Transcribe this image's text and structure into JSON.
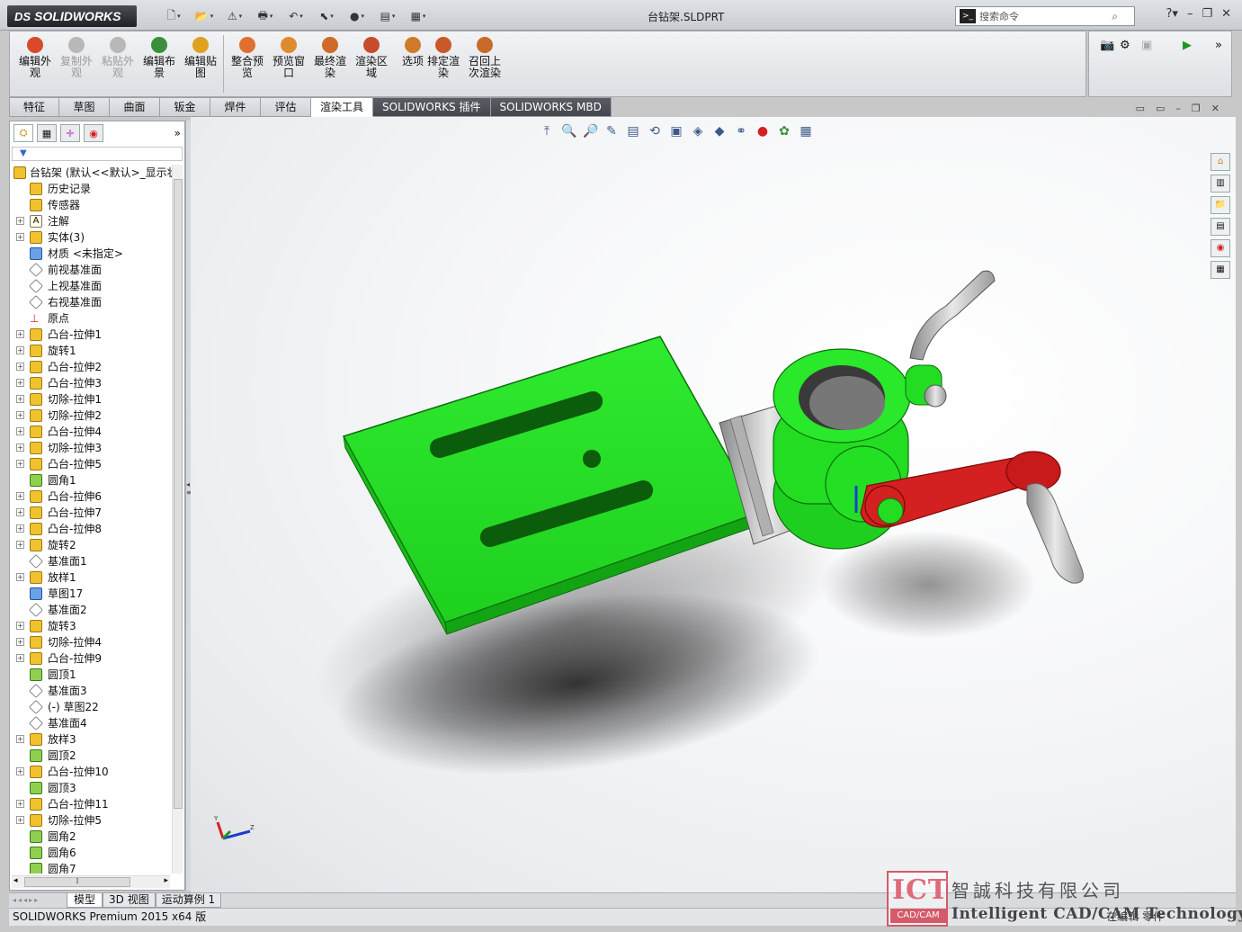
{
  "app": {
    "logo_text": "SOLIDWORKS",
    "logo_prefix": "DS",
    "document_title": "台钻架.SLDPRT",
    "search_placeholder": "搜索命令",
    "status_text": "SOLIDWORKS Premium 2015 x64 版",
    "status_right": "在编辑 零件"
  },
  "quick_access": [
    {
      "icon": "new-document-icon",
      "glyph": "🗋"
    },
    {
      "icon": "open-folder-icon",
      "glyph": "📂"
    },
    {
      "icon": "rebuild-icon",
      "glyph": "⚠"
    },
    {
      "icon": "print-icon",
      "glyph": "🖶"
    },
    {
      "icon": "undo-icon",
      "glyph": "↶"
    },
    {
      "icon": "select-icon",
      "glyph": "⬉"
    },
    {
      "icon": "traffic-light-icon",
      "glyph": "●"
    },
    {
      "icon": "file-properties-icon",
      "glyph": "▤"
    },
    {
      "icon": "options-icon",
      "glyph": "▦"
    }
  ],
  "commands": [
    {
      "name": "edit-appearance",
      "label": "编辑外观",
      "color": "#d94a2c",
      "disabled": false
    },
    {
      "name": "copy-appearance",
      "label": "复制外观",
      "color": "#b8b8b8",
      "disabled": true
    },
    {
      "name": "paste-appearance",
      "label": "粘贴外观",
      "color": "#b8b8b8",
      "disabled": true
    },
    {
      "name": "edit-scene",
      "label": "编辑布景",
      "color": "#3b8f3b",
      "disabled": false
    },
    {
      "name": "edit-decal",
      "label": "编辑贴图",
      "color": "#e0a020",
      "disabled": false
    },
    {
      "name": "integrated-preview",
      "label": "整合预览",
      "color": "#e07030",
      "disabled": false
    },
    {
      "name": "preview-window",
      "label": "预览窗口",
      "color": "#e08a30",
      "disabled": false
    },
    {
      "name": "final-render",
      "label": "最终渲染",
      "color": "#d06a28",
      "disabled": false
    },
    {
      "name": "render-region",
      "label": "渲染区域",
      "color": "#c84c2c",
      "disabled": false
    },
    {
      "name": "options",
      "label": "选项",
      "color": "#d07a2a",
      "disabled": false
    },
    {
      "name": "schedule-render",
      "label": "排定渲染",
      "color": "#c85a2a",
      "disabled": false
    },
    {
      "name": "recall-last-render",
      "label": "召回上次渲染",
      "color": "#c86a2a",
      "disabled": false
    }
  ],
  "tabs": [
    {
      "label": "特征",
      "active": false,
      "dark": false
    },
    {
      "label": "草图",
      "active": false,
      "dark": false
    },
    {
      "label": "曲面",
      "active": false,
      "dark": false
    },
    {
      "label": "钣金",
      "active": false,
      "dark": false
    },
    {
      "label": "焊件",
      "active": false,
      "dark": false
    },
    {
      "label": "评估",
      "active": false,
      "dark": false
    },
    {
      "label": "渲染工具",
      "active": true,
      "dark": false
    },
    {
      "label": "SOLIDWORKS 插件",
      "active": false,
      "dark": true
    },
    {
      "label": "SOLIDWORKS MBD",
      "active": false,
      "dark": true
    }
  ],
  "tree": {
    "root": "台钻架  (默认<<默认>_显示状",
    "nodes": [
      {
        "label": "历史记录",
        "icon": "history-icon",
        "cls": "yellow",
        "exp": false
      },
      {
        "label": "传感器",
        "icon": "sensor-icon",
        "cls": "yellow",
        "exp": false
      },
      {
        "label": "注解",
        "icon": "annotation-icon",
        "cls": "text",
        "glyph": "A",
        "exp": true
      },
      {
        "label": "实体(3)",
        "icon": "solid-bodies-icon",
        "cls": "yellow",
        "exp": true
      },
      {
        "label": "材质 <未指定>",
        "icon": "material-icon",
        "cls": "blue",
        "exp": false
      },
      {
        "label": "前视基准面",
        "icon": "plane-icon",
        "cls": "plane",
        "exp": false
      },
      {
        "label": "上视基准面",
        "icon": "plane-icon",
        "cls": "plane",
        "exp": false
      },
      {
        "label": "右视基准面",
        "icon": "plane-icon",
        "cls": "plane",
        "exp": false
      },
      {
        "label": "原点",
        "icon": "origin-icon",
        "cls": "origin",
        "glyph": "⊥",
        "exp": false
      },
      {
        "label": "凸台-拉伸1",
        "icon": "boss-extrude-icon",
        "cls": "yellow",
        "exp": true
      },
      {
        "label": "旋转1",
        "icon": "revolve-icon",
        "cls": "yellow",
        "exp": true
      },
      {
        "label": "凸台-拉伸2",
        "icon": "boss-extrude-icon",
        "cls": "yellow",
        "exp": true
      },
      {
        "label": "凸台-拉伸3",
        "icon": "boss-extrude-icon",
        "cls": "yellow",
        "exp": true
      },
      {
        "label": "切除-拉伸1",
        "icon": "cut-extrude-icon",
        "cls": "yellow",
        "exp": true
      },
      {
        "label": "切除-拉伸2",
        "icon": "cut-extrude-icon",
        "cls": "yellow",
        "exp": true
      },
      {
        "label": "凸台-拉伸4",
        "icon": "boss-extrude-icon",
        "cls": "yellow",
        "exp": true
      },
      {
        "label": "切除-拉伸3",
        "icon": "cut-extrude-icon",
        "cls": "yellow",
        "exp": true
      },
      {
        "label": "凸台-拉伸5",
        "icon": "boss-extrude-icon",
        "cls": "yellow",
        "exp": true
      },
      {
        "label": "圆角1",
        "icon": "fillet-icon",
        "cls": "green",
        "exp": false
      },
      {
        "label": "凸台-拉伸6",
        "icon": "boss-extrude-icon",
        "cls": "yellow",
        "exp": true
      },
      {
        "label": "凸台-拉伸7",
        "icon": "boss-extrude-icon",
        "cls": "yellow",
        "exp": true
      },
      {
        "label": "凸台-拉伸8",
        "icon": "boss-extrude-icon",
        "cls": "yellow",
        "exp": true
      },
      {
        "label": "旋转2",
        "icon": "revolve-icon",
        "cls": "yellow",
        "exp": true
      },
      {
        "label": "基准面1",
        "icon": "plane-icon",
        "cls": "plane",
        "exp": false
      },
      {
        "label": "放样1",
        "icon": "loft-icon",
        "cls": "yellow",
        "exp": true
      },
      {
        "label": "草图17",
        "icon": "sketch-icon",
        "cls": "blue",
        "exp": false
      },
      {
        "label": "基准面2",
        "icon": "plane-icon",
        "cls": "plane",
        "exp": false
      },
      {
        "label": "旋转3",
        "icon": "revolve-icon",
        "cls": "yellow",
        "exp": true
      },
      {
        "label": "切除-拉伸4",
        "icon": "cut-extrude-icon",
        "cls": "yellow",
        "exp": true
      },
      {
        "label": "凸台-拉伸9",
        "icon": "boss-extrude-icon",
        "cls": "yellow",
        "exp": true
      },
      {
        "label": "圆顶1",
        "icon": "dome-icon",
        "cls": "green",
        "exp": false
      },
      {
        "label": "基准面3",
        "icon": "plane-icon",
        "cls": "plane",
        "exp": false
      },
      {
        "label": "(-) 草图22",
        "icon": "sketch-icon",
        "cls": "plane",
        "exp": false
      },
      {
        "label": "基准面4",
        "icon": "plane-icon",
        "cls": "plane",
        "exp": false
      },
      {
        "label": "放样3",
        "icon": "loft-icon",
        "cls": "yellow",
        "exp": true
      },
      {
        "label": "圆顶2",
        "icon": "dome-icon",
        "cls": "green",
        "exp": false
      },
      {
        "label": "凸台-拉伸10",
        "icon": "boss-extrude-icon",
        "cls": "yellow",
        "exp": true
      },
      {
        "label": "圆顶3",
        "icon": "dome-icon",
        "cls": "green",
        "exp": false
      },
      {
        "label": "凸台-拉伸11",
        "icon": "boss-extrude-icon",
        "cls": "yellow",
        "exp": true
      },
      {
        "label": "切除-拉伸5",
        "icon": "cut-extrude-icon",
        "cls": "yellow",
        "exp": true
      },
      {
        "label": "圆角2",
        "icon": "fillet-icon",
        "cls": "green",
        "exp": false
      },
      {
        "label": "圆角6",
        "icon": "fillet-icon",
        "cls": "green",
        "exp": false
      },
      {
        "label": "圆角7",
        "icon": "fillet-icon",
        "cls": "green",
        "exp": false
      }
    ]
  },
  "bottom_tabs": [
    {
      "label": "模型",
      "active": true
    },
    {
      "label": "3D 视图",
      "active": false
    },
    {
      "label": "运动算例 1",
      "active": false
    }
  ],
  "watermark": {
    "logo": "ICT",
    "logo_sub": "CAD/CAM",
    "company_cn": "智誠科技有限公司",
    "company_en": "Intelligent CAD/CAM Technology Ltd."
  },
  "colors": {
    "model_green": "#22dd22",
    "handle_red": "#d42020",
    "metal": "#c8c8c8"
  }
}
